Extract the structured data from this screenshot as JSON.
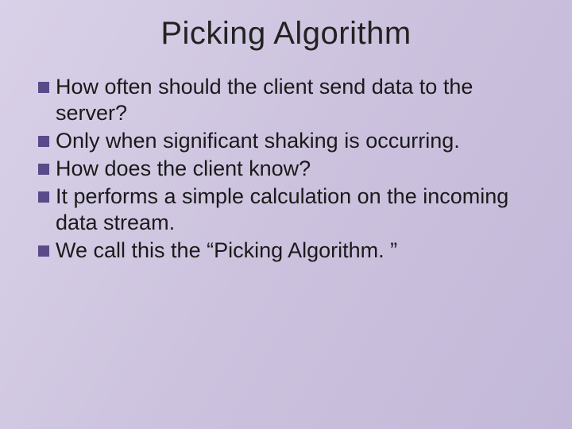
{
  "slide": {
    "title": "Picking Algorithm",
    "bullets": [
      "How often should the client send data to the server?",
      "Only when significant shaking is occurring.",
      "How does the client know?",
      "It performs a simple calculation on the incoming data stream.",
      "We call this the “Picking Algorithm. ”"
    ]
  }
}
